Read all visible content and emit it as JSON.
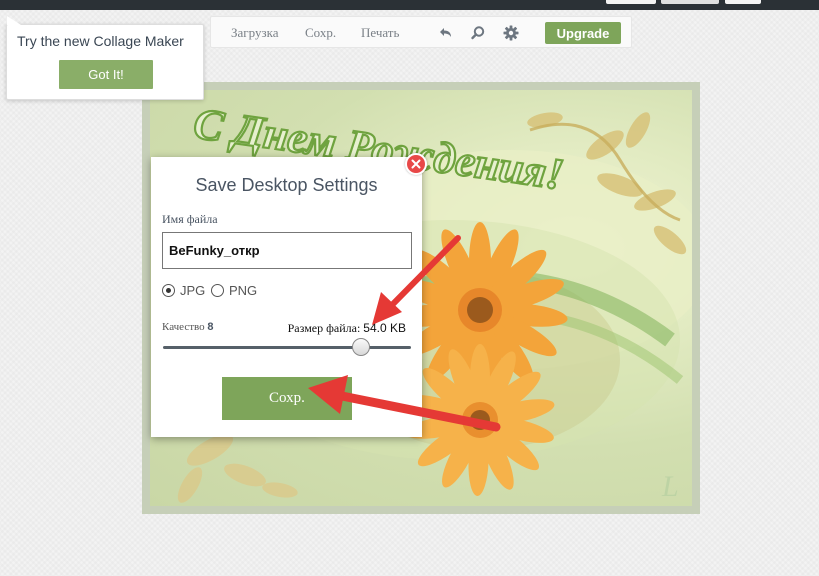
{
  "toolbar": {
    "links": [
      "Загрузка",
      "Сохр.",
      "Печать"
    ],
    "upgrade_label": "Upgrade",
    "icons": [
      "undo-icon",
      "search-icon",
      "gear-icon"
    ]
  },
  "tooltip": {
    "text": "Try the new Collage Maker",
    "button_label": "Got It!"
  },
  "card": {
    "greeting": "С Днем Рождения!"
  },
  "dialog": {
    "title": "Save Desktop Settings",
    "filename_label": "Имя файла",
    "filename_value": "BeFunky_откр",
    "formats": [
      {
        "label": "JPG",
        "selected": true
      },
      {
        "label": "PNG",
        "selected": false
      }
    ],
    "quality_label": "Качество",
    "quality_value": "8",
    "quality_fraction": 0.8,
    "size_label": "Размер файла:",
    "size_value": "54.0 KB",
    "save_label": "Сохр."
  },
  "colors": {
    "accent_green": "#7ea55a",
    "close_red": "#e84848",
    "annotation_arrow": "#e53935"
  }
}
